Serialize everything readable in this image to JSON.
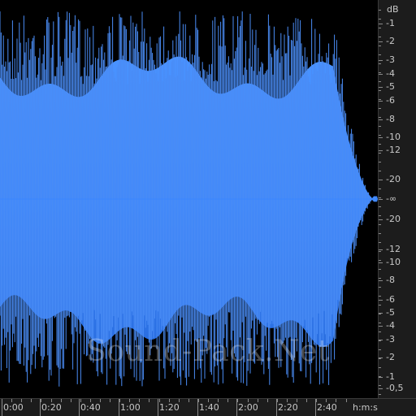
{
  "db_scale": {
    "unit": "dB",
    "top_labels": [
      "-1",
      "-2",
      "-3",
      "-4",
      "-5",
      "-6",
      "-8",
      "-10",
      "-12",
      "-20"
    ],
    "center_label": "-∞",
    "bottom_labels": [
      "-20",
      "-12",
      "-10",
      "-8",
      "-6",
      "-5",
      "-4",
      "-3",
      "-2",
      "-1",
      "-0,5"
    ]
  },
  "time_scale": {
    "labels": [
      "0:00",
      "0:20",
      "0:40",
      "1:00",
      "1:20",
      "1:40",
      "2:00",
      "2:20",
      "2:40"
    ],
    "unit": "h:m:s"
  },
  "watermark": {
    "text": "Sound-Pack.Net"
  },
  "colors": {
    "waveform_top": "#3f8cff",
    "waveform_bottom": "#2a6ee0",
    "background": "#000000",
    "ruler_bg": "#1c1c1c",
    "ruler_text": "#c8c8c8"
  }
}
